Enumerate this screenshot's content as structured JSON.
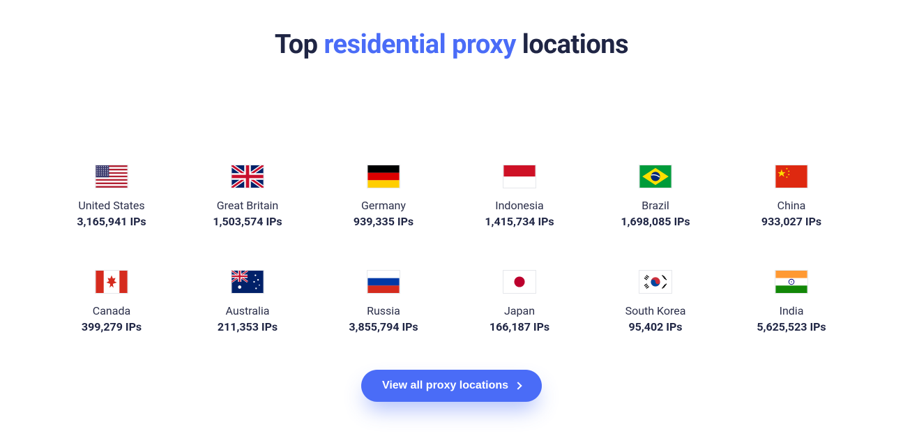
{
  "heading": {
    "pre": "Top ",
    "accent": "residential proxy",
    "post": " locations"
  },
  "locations": [
    {
      "name": "United States",
      "ips": "3,165,941 IPs",
      "flag": "us"
    },
    {
      "name": "Great Britain",
      "ips": "1,503,574 IPs",
      "flag": "gb"
    },
    {
      "name": "Germany",
      "ips": "939,335 IPs",
      "flag": "de"
    },
    {
      "name": "Indonesia",
      "ips": "1,415,734 IPs",
      "flag": "id"
    },
    {
      "name": "Brazil",
      "ips": "1,698,085 IPs",
      "flag": "br"
    },
    {
      "name": "China",
      "ips": "933,027 IPs",
      "flag": "cn"
    },
    {
      "name": "Canada",
      "ips": "399,279 IPs",
      "flag": "ca"
    },
    {
      "name": "Australia",
      "ips": "211,353 IPs",
      "flag": "au"
    },
    {
      "name": "Russia",
      "ips": "3,855,794 IPs",
      "flag": "ru"
    },
    {
      "name": "Japan",
      "ips": "166,187 IPs",
      "flag": "jp"
    },
    {
      "name": "South Korea",
      "ips": "95,402 IPs",
      "flag": "kr"
    },
    {
      "name": "India",
      "ips": "5,625,523 IPs",
      "flag": "in"
    }
  ],
  "cta": {
    "label": "View all proxy locations"
  },
  "colors": {
    "accent": "#4a6cf7",
    "text": "#1f2544"
  }
}
